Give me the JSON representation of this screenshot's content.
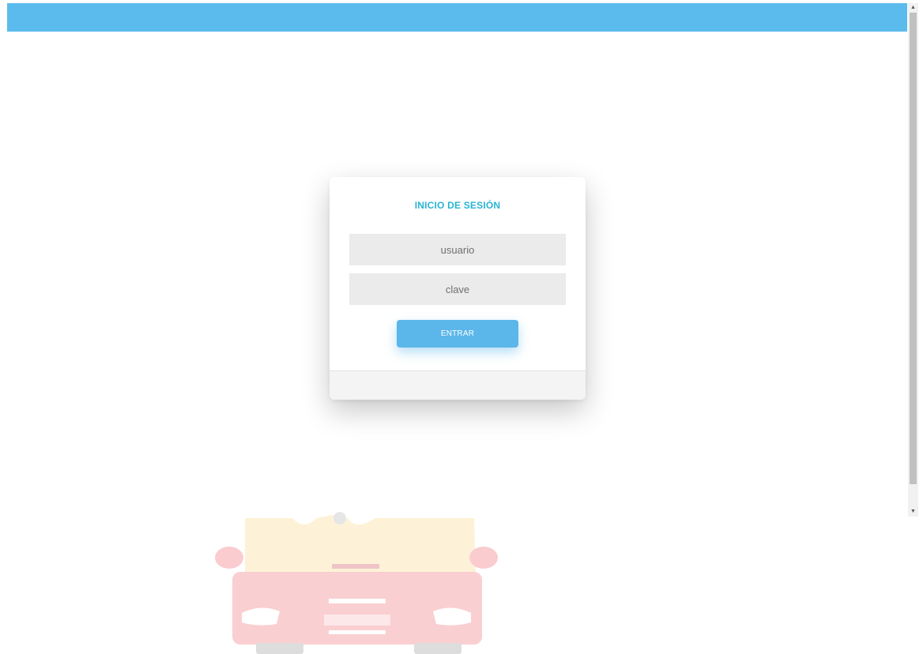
{
  "login": {
    "title": "INICIO DE SESIÓN",
    "username_placeholder": "usuario",
    "password_placeholder": "clave",
    "submit_label": "ENTRAR"
  },
  "colors": {
    "top_bar": "#5bbbec",
    "title": "#2ab4d4",
    "button": "#5bb6ea"
  },
  "icons": {
    "scroll_up": "scroll-up-arrow",
    "scroll_down": "scroll-down-arrow",
    "illustration": "car-illustration"
  }
}
